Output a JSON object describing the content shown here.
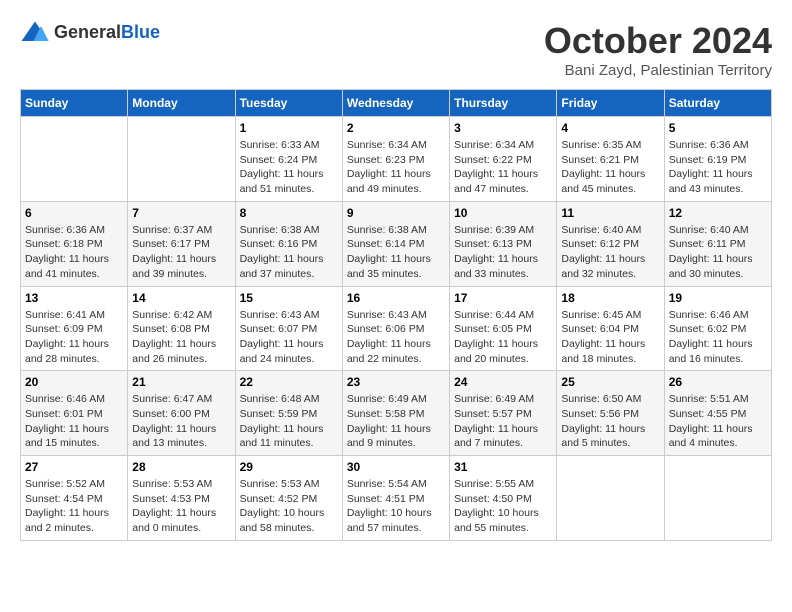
{
  "logo": {
    "general": "General",
    "blue": "Blue"
  },
  "header": {
    "month": "October 2024",
    "location": "Bani Zayd, Palestinian Territory"
  },
  "weekdays": [
    "Sunday",
    "Monday",
    "Tuesday",
    "Wednesday",
    "Thursday",
    "Friday",
    "Saturday"
  ],
  "weeks": [
    [
      {
        "day": "",
        "info": ""
      },
      {
        "day": "",
        "info": ""
      },
      {
        "day": "1",
        "info": "Sunrise: 6:33 AM\nSunset: 6:24 PM\nDaylight: 11 hours and 51 minutes."
      },
      {
        "day": "2",
        "info": "Sunrise: 6:34 AM\nSunset: 6:23 PM\nDaylight: 11 hours and 49 minutes."
      },
      {
        "day": "3",
        "info": "Sunrise: 6:34 AM\nSunset: 6:22 PM\nDaylight: 11 hours and 47 minutes."
      },
      {
        "day": "4",
        "info": "Sunrise: 6:35 AM\nSunset: 6:21 PM\nDaylight: 11 hours and 45 minutes."
      },
      {
        "day": "5",
        "info": "Sunrise: 6:36 AM\nSunset: 6:19 PM\nDaylight: 11 hours and 43 minutes."
      }
    ],
    [
      {
        "day": "6",
        "info": "Sunrise: 6:36 AM\nSunset: 6:18 PM\nDaylight: 11 hours and 41 minutes."
      },
      {
        "day": "7",
        "info": "Sunrise: 6:37 AM\nSunset: 6:17 PM\nDaylight: 11 hours and 39 minutes."
      },
      {
        "day": "8",
        "info": "Sunrise: 6:38 AM\nSunset: 6:16 PM\nDaylight: 11 hours and 37 minutes."
      },
      {
        "day": "9",
        "info": "Sunrise: 6:38 AM\nSunset: 6:14 PM\nDaylight: 11 hours and 35 minutes."
      },
      {
        "day": "10",
        "info": "Sunrise: 6:39 AM\nSunset: 6:13 PM\nDaylight: 11 hours and 33 minutes."
      },
      {
        "day": "11",
        "info": "Sunrise: 6:40 AM\nSunset: 6:12 PM\nDaylight: 11 hours and 32 minutes."
      },
      {
        "day": "12",
        "info": "Sunrise: 6:40 AM\nSunset: 6:11 PM\nDaylight: 11 hours and 30 minutes."
      }
    ],
    [
      {
        "day": "13",
        "info": "Sunrise: 6:41 AM\nSunset: 6:09 PM\nDaylight: 11 hours and 28 minutes."
      },
      {
        "day": "14",
        "info": "Sunrise: 6:42 AM\nSunset: 6:08 PM\nDaylight: 11 hours and 26 minutes."
      },
      {
        "day": "15",
        "info": "Sunrise: 6:43 AM\nSunset: 6:07 PM\nDaylight: 11 hours and 24 minutes."
      },
      {
        "day": "16",
        "info": "Sunrise: 6:43 AM\nSunset: 6:06 PM\nDaylight: 11 hours and 22 minutes."
      },
      {
        "day": "17",
        "info": "Sunrise: 6:44 AM\nSunset: 6:05 PM\nDaylight: 11 hours and 20 minutes."
      },
      {
        "day": "18",
        "info": "Sunrise: 6:45 AM\nSunset: 6:04 PM\nDaylight: 11 hours and 18 minutes."
      },
      {
        "day": "19",
        "info": "Sunrise: 6:46 AM\nSunset: 6:02 PM\nDaylight: 11 hours and 16 minutes."
      }
    ],
    [
      {
        "day": "20",
        "info": "Sunrise: 6:46 AM\nSunset: 6:01 PM\nDaylight: 11 hours and 15 minutes."
      },
      {
        "day": "21",
        "info": "Sunrise: 6:47 AM\nSunset: 6:00 PM\nDaylight: 11 hours and 13 minutes."
      },
      {
        "day": "22",
        "info": "Sunrise: 6:48 AM\nSunset: 5:59 PM\nDaylight: 11 hours and 11 minutes."
      },
      {
        "day": "23",
        "info": "Sunrise: 6:49 AM\nSunset: 5:58 PM\nDaylight: 11 hours and 9 minutes."
      },
      {
        "day": "24",
        "info": "Sunrise: 6:49 AM\nSunset: 5:57 PM\nDaylight: 11 hours and 7 minutes."
      },
      {
        "day": "25",
        "info": "Sunrise: 6:50 AM\nSunset: 5:56 PM\nDaylight: 11 hours and 5 minutes."
      },
      {
        "day": "26",
        "info": "Sunrise: 5:51 AM\nSunset: 4:55 PM\nDaylight: 11 hours and 4 minutes."
      }
    ],
    [
      {
        "day": "27",
        "info": "Sunrise: 5:52 AM\nSunset: 4:54 PM\nDaylight: 11 hours and 2 minutes."
      },
      {
        "day": "28",
        "info": "Sunrise: 5:53 AM\nSunset: 4:53 PM\nDaylight: 11 hours and 0 minutes."
      },
      {
        "day": "29",
        "info": "Sunrise: 5:53 AM\nSunset: 4:52 PM\nDaylight: 10 hours and 58 minutes."
      },
      {
        "day": "30",
        "info": "Sunrise: 5:54 AM\nSunset: 4:51 PM\nDaylight: 10 hours and 57 minutes."
      },
      {
        "day": "31",
        "info": "Sunrise: 5:55 AM\nSunset: 4:50 PM\nDaylight: 10 hours and 55 minutes."
      },
      {
        "day": "",
        "info": ""
      },
      {
        "day": "",
        "info": ""
      }
    ]
  ]
}
